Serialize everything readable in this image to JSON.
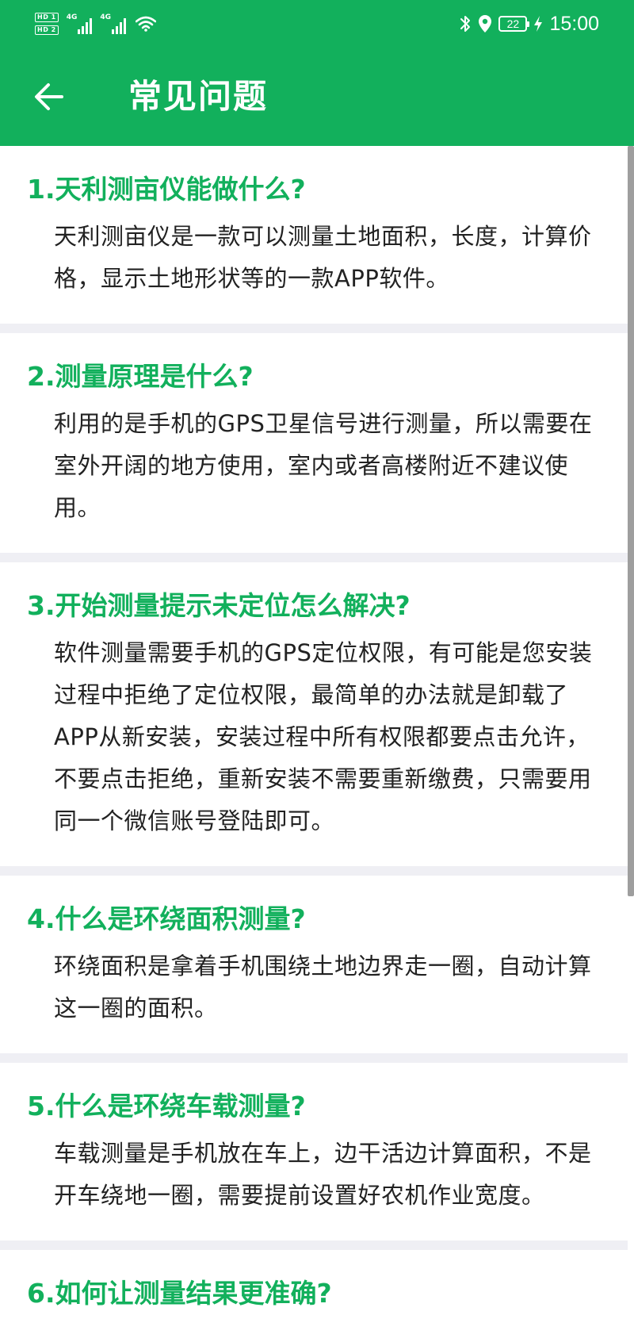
{
  "status_bar": {
    "sim1_label": "HD 1",
    "sim2_label": "HD 2",
    "network1": "4G",
    "network2": "4G",
    "battery_level": "22",
    "time": "15:00",
    "icons": [
      "bluetooth-icon",
      "location-icon",
      "charging-bolt-icon",
      "wifi-icon"
    ]
  },
  "header": {
    "back_icon": "arrow-left-icon",
    "title": "常见问题"
  },
  "colors": {
    "accent": "#12b05c",
    "background": "#efeff4",
    "answer_text": "#222222"
  },
  "faq": [
    {
      "question": "1.天利测亩仪能做什么?",
      "answer": "天利测亩仪是一款可以测量土地面积，长度，计算价格，显示土地形状等的一款APP软件。"
    },
    {
      "question": "2.测量原理是什么?",
      "answer": "利用的是手机的GPS卫星信号进行测量，所以需要在室外开阔的地方使用，室内或者高楼附近不建议使用。"
    },
    {
      "question": "3.开始测量提示未定位怎么解决?",
      "answer": "软件测量需要手机的GPS定位权限，有可能是您安装过程中拒绝了定位权限，最简单的办法就是卸载了APP从新安装，安装过程中所有权限都要点击允许，不要点击拒绝，重新安装不需要重新缴费，只需要用同一个微信账号登陆即可。"
    },
    {
      "question": "4.什么是环绕面积测量?",
      "answer": "环绕面积是拿着手机围绕土地边界走一圈，自动计算这一圈的面积。"
    },
    {
      "question": "5.什么是环绕车载测量?",
      "answer": "车载测量是手机放在车上，边干活边计算面积，不是开车绕地一圈，需要提前设置好农机作业宽度。"
    },
    {
      "question": "6.如何让测量结果更准确?",
      "answer": ""
    }
  ]
}
